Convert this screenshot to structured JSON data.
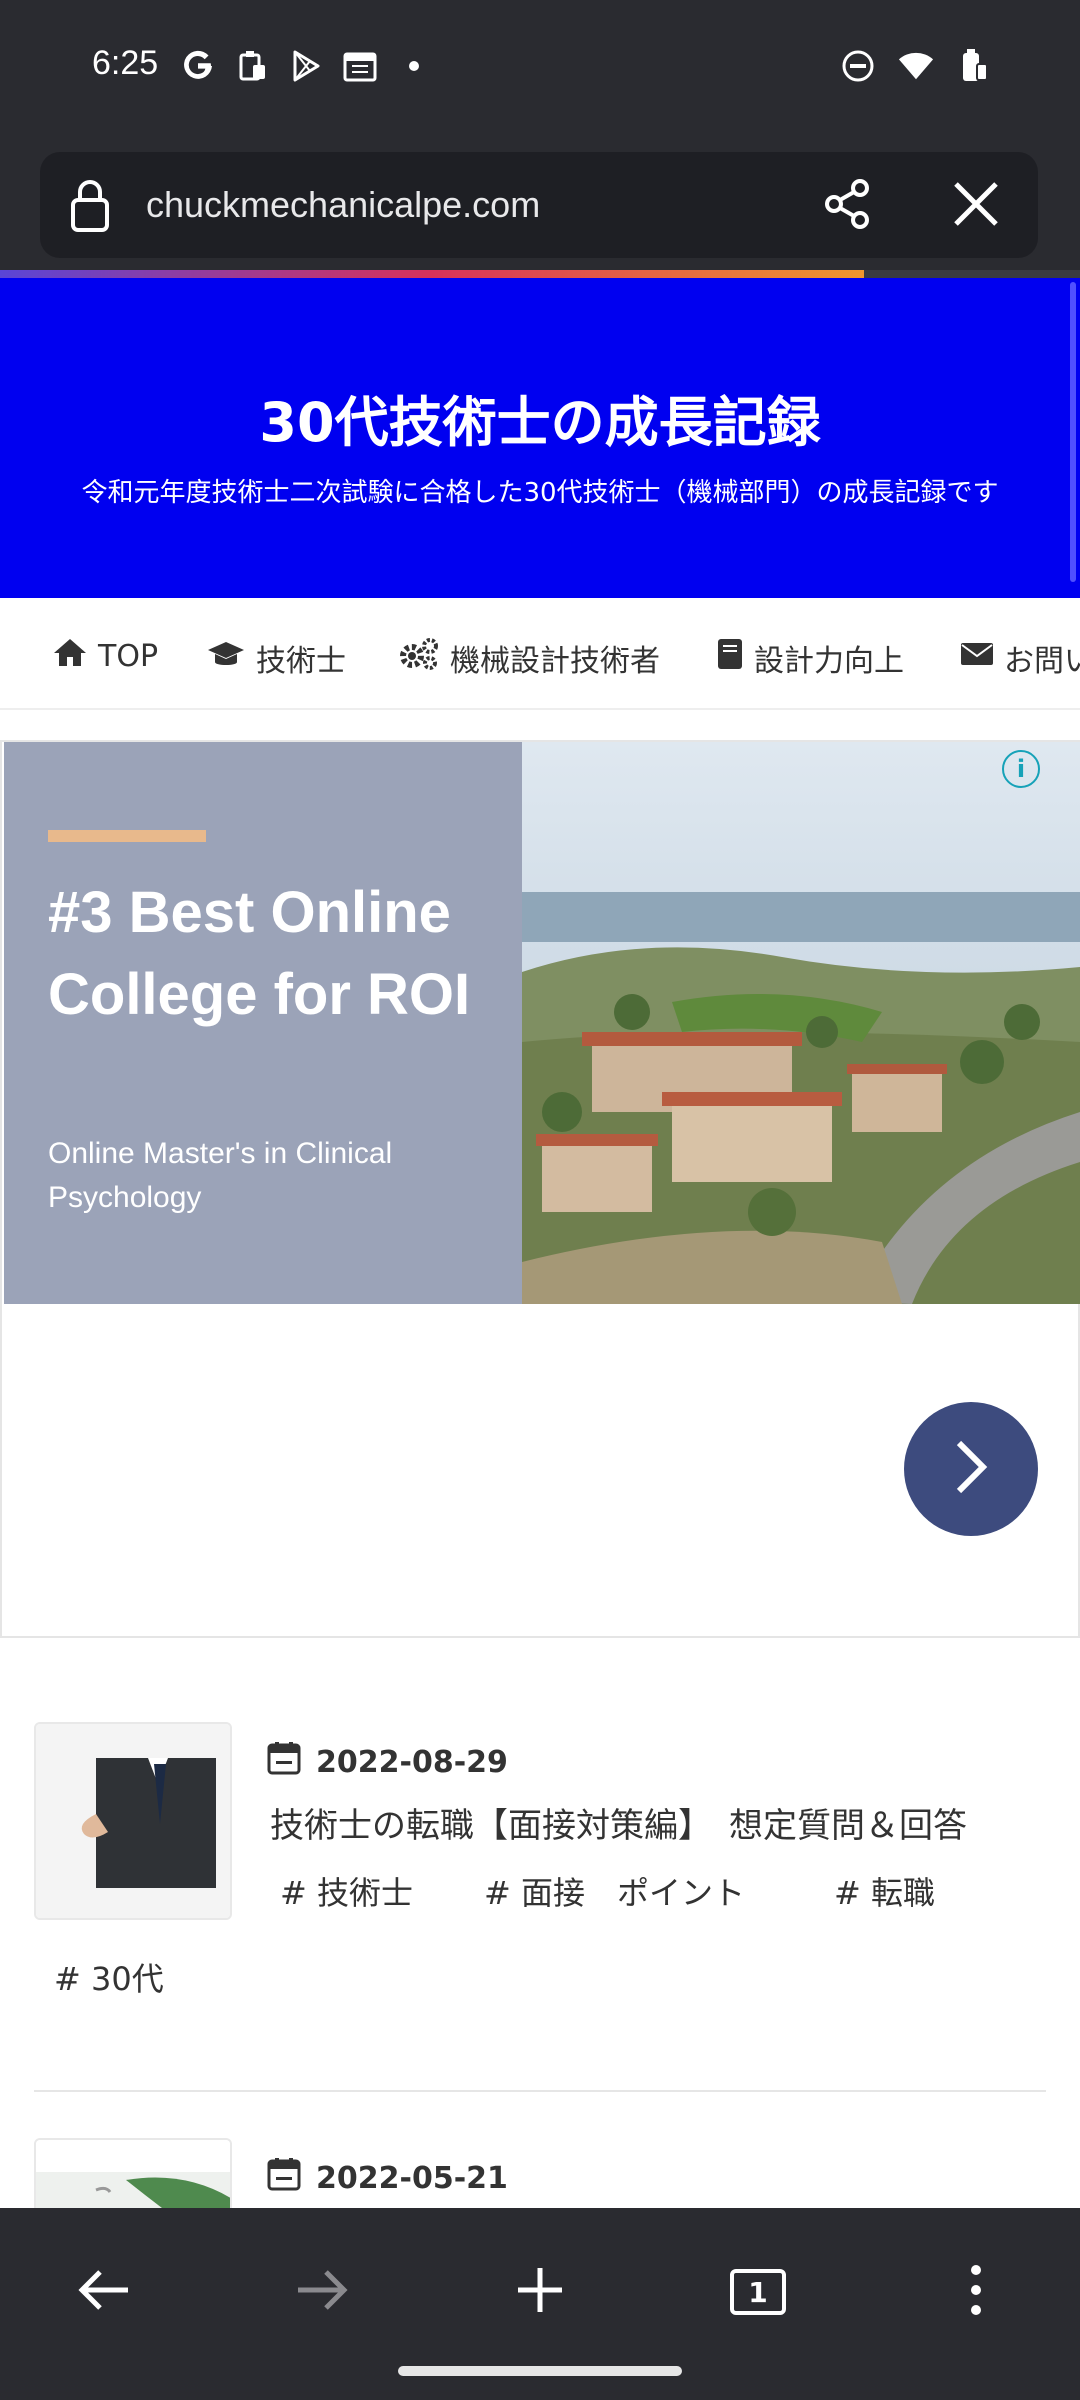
{
  "status_bar": {
    "time": "6:25",
    "left_icons": [
      "google-icon",
      "clipboard-icon",
      "play-store-icon",
      "calendar-icon",
      "dot-icon"
    ],
    "right_icons": [
      "dnd-icon",
      "wifi-icon",
      "battery-icon"
    ]
  },
  "browser": {
    "url": "chuckmechanicalpe.com",
    "load_progress": 0.8
  },
  "site": {
    "title": "30代技術士の成長記録",
    "subtitle": "令和元年度技術士二次試験に合格した30代技術士（機械部門）の成長記録です",
    "header_color": "#0000f0"
  },
  "nav": [
    {
      "label": "TOP",
      "icon": "home-icon"
    },
    {
      "label": "技術士",
      "icon": "graduation-cap-icon"
    },
    {
      "label": "機械設計技術者",
      "icon": "gears-icon"
    },
    {
      "label": "設計力向上",
      "icon": "book-icon"
    },
    {
      "label": "お問い",
      "icon": "envelope-icon"
    }
  ],
  "ad": {
    "headline": "#3 Best Online College for ROI",
    "subline": "Online Master's in Clinical Psychology"
  },
  "posts": [
    {
      "date": "2022-08-29",
      "title": "技術士の転職【面接対策編】　想定質問＆回答",
      "tags": [
        "# 技術士",
        "# 面接　ポイント",
        "# 転職",
        "# 30代"
      ]
    },
    {
      "date": "2022-05-21"
    }
  ],
  "bottom_bar": [
    "back-icon",
    "forward-icon",
    "new-tab-icon",
    "tab-count-icon",
    "more-icon"
  ],
  "tab_count": "1"
}
